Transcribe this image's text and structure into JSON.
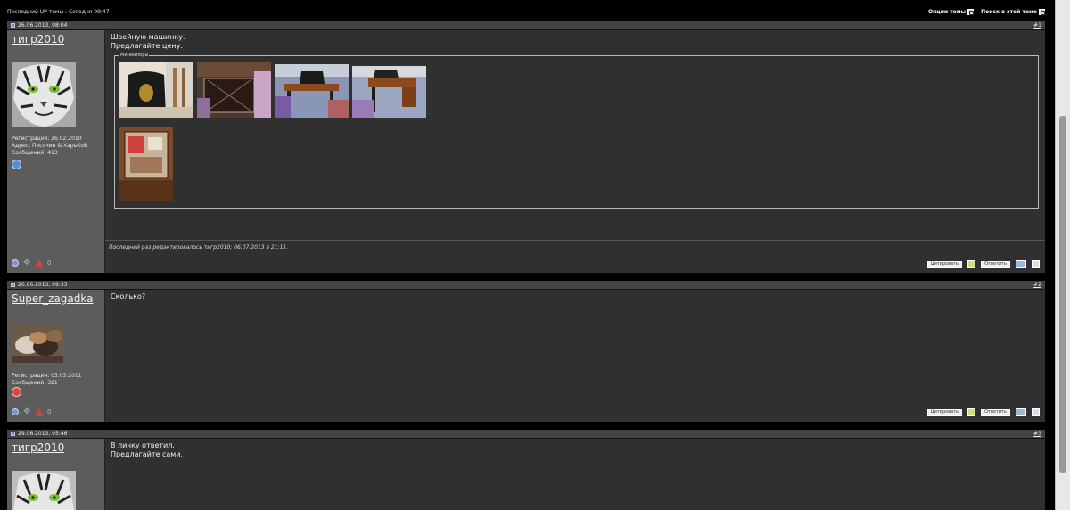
{
  "topbar": {
    "last_up": "Последний UP темы : Сегодня 09:47",
    "thread_options": "Опции темы",
    "search_thread": "Поиск в этой теме"
  },
  "posts": [
    {
      "date": "26.06.2013, 08:04",
      "number": "#1",
      "username": "тигр2010",
      "registration": "Регистрация: 26.02.2010",
      "address": "Адрес: Песочин & ХарьКоВ",
      "messages": "Сообщений: 413",
      "text": "Швейную машинку.\nПредлагайте цену.",
      "attachments_legend": "Миниатюры",
      "edit_note": "Последний раз редактировалось тигр2010; 06.07.2013 в 21:11.",
      "quote_label": "Цитировать",
      "reply_label": "Ответить"
    },
    {
      "date": "26.06.2013, 09:33",
      "number": "#2",
      "username": "Super_zagadka",
      "registration": "Регистрация: 03.03.2011",
      "messages": "Сообщений: 321",
      "text": "Сколько?",
      "quote_label": "Цитировать",
      "reply_label": "Ответить"
    },
    {
      "date": "29.06.2013, 05:46",
      "number": "#3",
      "username": "тигр2010",
      "text": "В личку ответил.\nПредлагайте сами."
    }
  ],
  "colors": {
    "background": "#000000",
    "post_body": "#303030",
    "user_panel": "#5c5c5c",
    "post_header": "#444444"
  }
}
